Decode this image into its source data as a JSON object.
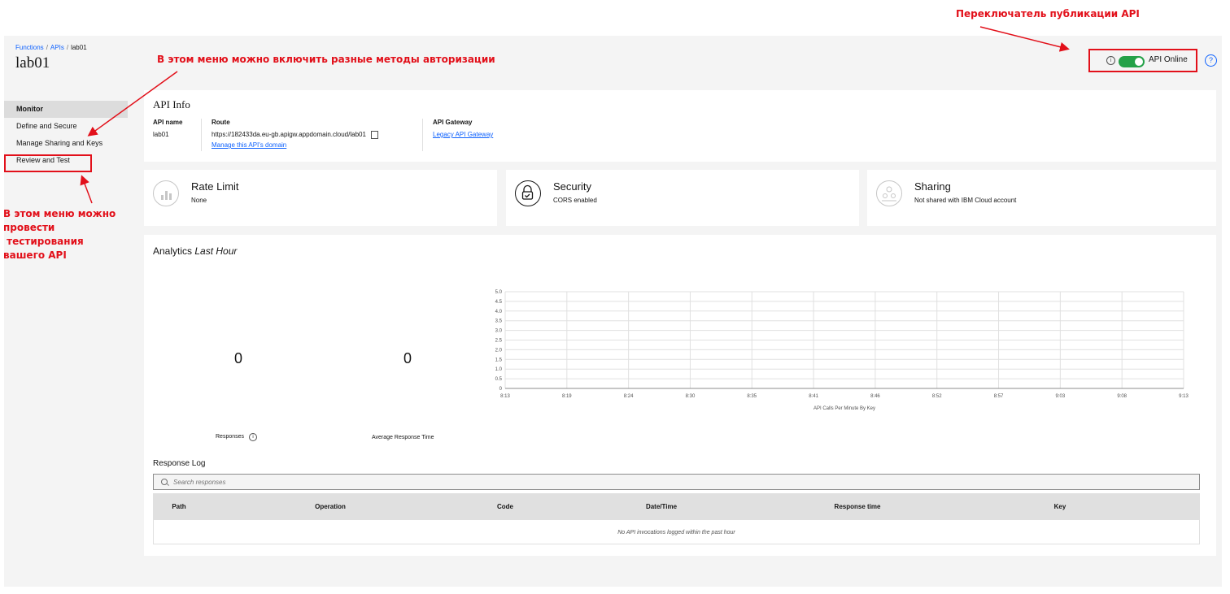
{
  "breadcrumb": {
    "functions": "Functions",
    "apis": "APIs",
    "current": "lab01"
  },
  "page_title": "lab01",
  "sidebar": {
    "items": [
      {
        "label": "Monitor",
        "active": true
      },
      {
        "label": "Define and Secure"
      },
      {
        "label": "Manage Sharing and Keys"
      },
      {
        "label": "Review and Test"
      }
    ]
  },
  "header": {
    "toggle_label": "API Online",
    "toggle_on": true
  },
  "api_info": {
    "title": "API Info",
    "api_name_header": "API name",
    "api_name": "lab01",
    "route_header": "Route",
    "route": "https://182433da.eu-gb.apigw.appdomain.cloud/lab01",
    "route_link": "Manage this API's domain",
    "gateway_header": "API Gateway",
    "gateway_link": "Legacy API Gateway"
  },
  "tiles": {
    "rate_limit": {
      "title": "Rate Limit",
      "sub": "None"
    },
    "security": {
      "title": "Security",
      "sub": "CORS enabled"
    },
    "sharing": {
      "title": "Sharing",
      "sub": "Not shared with IBM Cloud account"
    }
  },
  "analytics": {
    "title": "Analytics",
    "title_em": "Last Hour",
    "responses_value": "0",
    "responses_label": "Responses",
    "avg_value": "0",
    "avg_label": "Average Response Time"
  },
  "chart_data": {
    "type": "line",
    "x": [
      "8:13",
      "8:19",
      "8:24",
      "8:30",
      "8:35",
      "8:41",
      "8:46",
      "8:52",
      "8:57",
      "9:03",
      "9:08",
      "9:13"
    ],
    "series": [],
    "xlabel": "API Calls Per Minute By Key",
    "ylabel": "",
    "yticks": [
      "0",
      "0.5",
      "1.0",
      "1.5",
      "2.0",
      "2.5",
      "3.0",
      "3.5",
      "4.0",
      "4.5",
      "5.0"
    ],
    "ylim": [
      0,
      5
    ],
    "grid": true
  },
  "response_log": {
    "title": "Response Log",
    "search_placeholder": "Search responses",
    "columns": [
      "Path",
      "Operation",
      "Code",
      "Date/Time",
      "Response time",
      "Key"
    ],
    "empty": "No API invocations logged within the past hour"
  },
  "annotations": {
    "toggle": "Переключатель публикации API",
    "menu": "В этом меню можно включить разные методы авторизации",
    "test_lines": [
      "В этом меню можно",
      "провести",
      " тестирования",
      "вашего API"
    ]
  },
  "colors": {
    "accent": "#0f62fe",
    "toggle_on": "#24a148",
    "annotation": "#e2101a"
  }
}
